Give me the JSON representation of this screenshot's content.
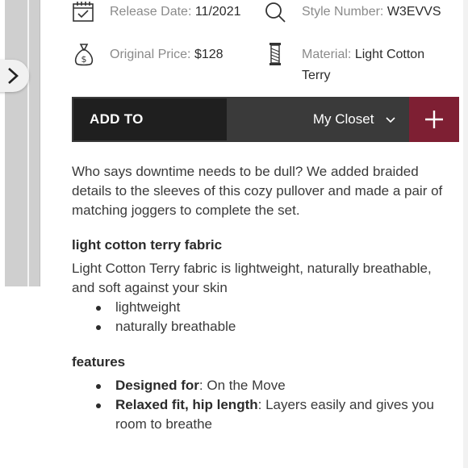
{
  "specs": {
    "release_label": "Release Date:",
    "release_value": "11/2021",
    "style_label": "Style Number:",
    "style_value": "W3EVVS",
    "price_label": "Original Price:",
    "price_value": "$128",
    "material_label": "Material:",
    "material_value_line1": "Light Cotton",
    "material_value_line2": "Terry"
  },
  "add_bar": {
    "add_to_label": "ADD TO",
    "closet_label": "My Closet",
    "plus_icon": "plus-icon",
    "accent_color": "#7e1f33"
  },
  "description": {
    "lines": [
      "Who says downtime needs to be dull? We added braided",
      "details to the sleeves of this cozy pullover and made a pair of",
      "matching joggers to complete the set."
    ]
  },
  "fabric": {
    "heading": "light cotton terry fabric",
    "lines": [
      "Light Cotton Terry fabric is lightweight, naturally breathable,",
      "and soft against your skin"
    ],
    "bullets": [
      "lightweight",
      "naturally breathable"
    ]
  },
  "features": {
    "heading": "features",
    "items": [
      {
        "bold": "Designed for",
        "rest": ": On the Move",
        "rest2": ""
      },
      {
        "bold": "Relaxed fit, hip length",
        "rest": ": Layers easily and gives you",
        "rest2": "room to breathe"
      }
    ]
  },
  "icons": [
    "calendar-icon",
    "search-icon",
    "money-bag-icon",
    "thread-spool-icon",
    "chevron-right-icon",
    "chevron-down-icon"
  ]
}
